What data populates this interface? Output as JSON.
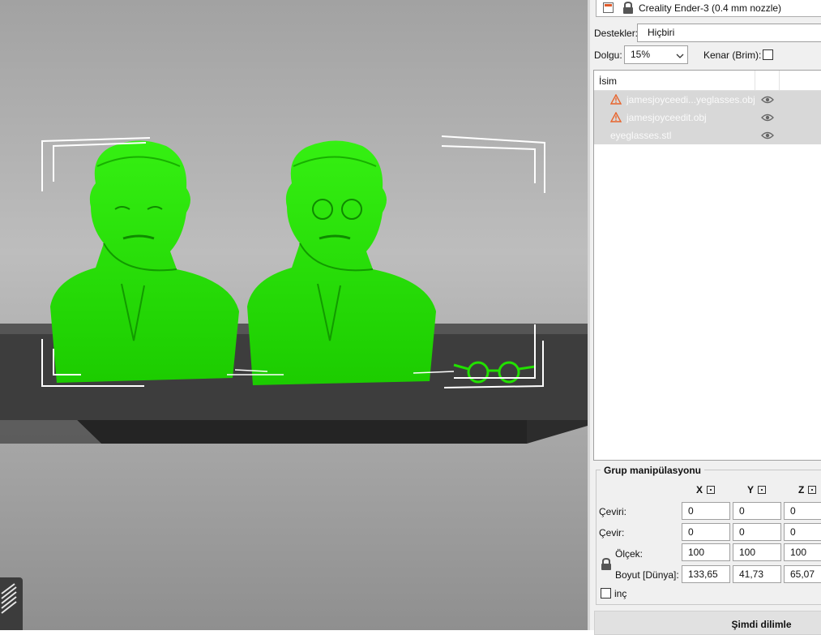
{
  "printer": {
    "name": "Creality Ender-3 (0.4 mm nozzle)"
  },
  "print_settings": {
    "support_label": "Destekler:",
    "support_value": "Hiçbiri",
    "infill_label": "Dolgu:",
    "infill_value": "15%",
    "adhesion_label": "Kenar (Brim):"
  },
  "object_list": {
    "column_name": "İsim",
    "items": [
      {
        "name": "jamesjoyceedi...yeglasses.obj",
        "warning": true
      },
      {
        "name": "jamesjoyceedit.obj",
        "warning": true
      },
      {
        "name": "eyeglasses.stl",
        "warning": false
      }
    ]
  },
  "group_manipulation": {
    "title": "Grup manipülasyonu",
    "axes": [
      "X",
      "Y",
      "Z"
    ],
    "rows": [
      {
        "label": "Çeviri:",
        "values": [
          "0",
          "0",
          "0"
        ]
      },
      {
        "label": "Çevir:",
        "values": [
          "0",
          "0",
          "0"
        ]
      },
      {
        "label": "Ölçek:",
        "values": [
          "100",
          "100",
          "100"
        ]
      },
      {
        "label": "Boyut [Dünya]:",
        "values": [
          "133,65",
          "41,73",
          "65,07"
        ]
      }
    ],
    "inch_label": "inç"
  },
  "slice_button": "Şimdi dilimle",
  "colors": {
    "model": "#22e000",
    "bed": "#3a3a3a",
    "panel": "#f0f0f0",
    "selected_row": "#d8d8d8",
    "warning": "#e8642c"
  }
}
